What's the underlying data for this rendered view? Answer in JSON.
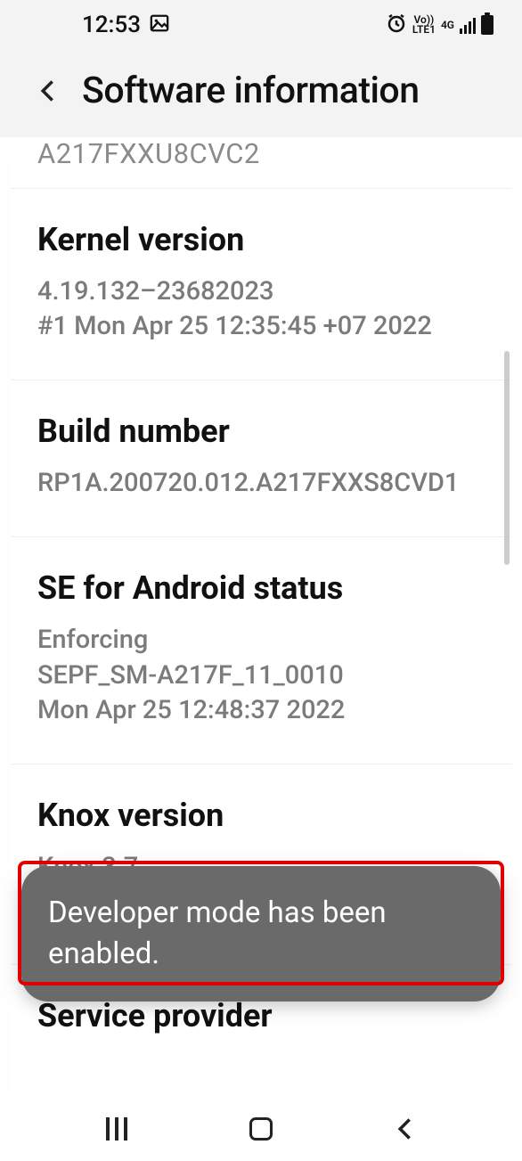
{
  "statusbar": {
    "time": "12:53",
    "volte": "Vo))\nLTE1",
    "net": "4G"
  },
  "header": {
    "title": "Software information"
  },
  "partial_above": "A217FXXU8CVC2",
  "items": {
    "kernel": {
      "title": "Kernel version",
      "value": "4.19.132–23682023\n#1 Mon Apr 25 12:35:45 +07 2022"
    },
    "build": {
      "title": "Build number",
      "value": "RP1A.200720.012.A217FXXS8CVD1"
    },
    "se": {
      "title": "SE for Android status",
      "value": "Enforcing\nSEPF_SM-A217F_11_0010\nMon Apr 25 12:48:37 2022"
    },
    "knox": {
      "title": "Knox version",
      "value": "Knox 3.7\nKnox API level 33"
    },
    "service": {
      "title": "Service provider"
    }
  },
  "toast": "Developer mode has been enabled."
}
